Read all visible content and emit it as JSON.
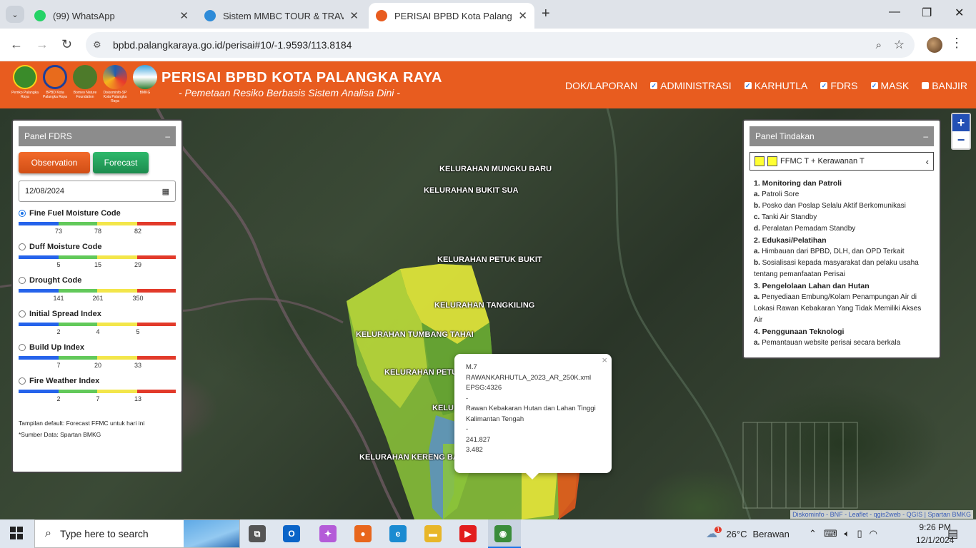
{
  "browser": {
    "tabs": [
      {
        "title": "(99) WhatsApp",
        "icon": "whatsapp-icon",
        "color": "#25d366"
      },
      {
        "title": "Sistem MMBC TOUR & TRAVEL",
        "icon": "site-icon",
        "color": "#2e8bd8"
      },
      {
        "title": "PERISAI BPBD Kota Palangka Ra",
        "icon": "bpbd-icon",
        "color": "#e85c1f"
      }
    ],
    "url": "bpbd.palangkaraya.go.id/perisai#10/-1.9593/113.8184"
  },
  "header": {
    "title": "PERISAI BPBD KOTA PALANGKA RAYA",
    "subtitle": "- Pemetaan Resiko Berbasis Sistem Analisa Dini -",
    "logos": [
      {
        "caption": "Pemko Palangka Raya",
        "color": "#3a8b2a"
      },
      {
        "caption": "BPBD Kota Palangka Raya",
        "color": "#1d3f9a"
      },
      {
        "caption": "Borneo Nature Foundation",
        "color": "#4d7a2a"
      },
      {
        "caption": "Diskominfo-SP Kota Palangka Raya",
        "color": "#1f5fb0"
      },
      {
        "caption": "BMKG",
        "color": "#2f86c7"
      }
    ],
    "nav": [
      {
        "label": "DOK/LAPORAN",
        "checkbox": false
      },
      {
        "label": "ADMINISTRASI",
        "checkbox": true,
        "checked": true
      },
      {
        "label": "KARHUTLA",
        "checkbox": true,
        "checked": true
      },
      {
        "label": "FDRS",
        "checkbox": true,
        "checked": true
      },
      {
        "label": "MASK",
        "checkbox": true,
        "checked": true
      },
      {
        "label": "BANJIR",
        "checkbox": true,
        "checked": false
      }
    ]
  },
  "panel_fdrs": {
    "title": "Panel FDRS",
    "collapse": "–",
    "observation_label": "Observation",
    "forecast_label": "Forecast",
    "date": "12/08/2024",
    "indices": [
      {
        "name": "Fine Fuel Moisture Code",
        "selected": true,
        "ticks": [
          "73",
          "78",
          "82"
        ]
      },
      {
        "name": "Duff Moisture Code",
        "selected": false,
        "ticks": [
          "5",
          "15",
          "29"
        ]
      },
      {
        "name": "Drought Code",
        "selected": false,
        "ticks": [
          "141",
          "261",
          "350"
        ]
      },
      {
        "name": "Initial Spread Index",
        "selected": false,
        "ticks": [
          "2",
          "4",
          "5"
        ]
      },
      {
        "name": "Build Up Index",
        "selected": false,
        "ticks": [
          "7",
          "20",
          "33"
        ]
      },
      {
        "name": "Fire Weather Index",
        "selected": false,
        "ticks": [
          "2",
          "7",
          "13"
        ]
      }
    ],
    "scale_colors": [
      "#2563eb",
      "#62c95a",
      "#f3e64a",
      "#e23a2a"
    ],
    "note1": "Tampilan default: Forecast FFMC untuk hari ini",
    "note2": "*Sumber Data: Spartan BMKG"
  },
  "panel_tindakan": {
    "title": "Panel Tindakan",
    "collapse": "–",
    "select_label": "FFMC T + Kerawanan T",
    "sections": [
      {
        "head": "1. Monitoring dan Patroli",
        "items": [
          {
            "k": "a.",
            "t": "Patroli Sore"
          },
          {
            "k": "b.",
            "t": "Posko dan Poslap Selalu Aktif Berkomunikasi"
          },
          {
            "k": "c.",
            "t": "Tanki Air Standby"
          },
          {
            "k": "d.",
            "t": "Peralatan Pemadam Standby"
          }
        ]
      },
      {
        "head": "2. Edukasi/Pelatihan",
        "items": [
          {
            "k": "a.",
            "t": "Himbauan dari BPBD, DLH, dan OPD Terkait"
          },
          {
            "k": "b.",
            "t": "Sosialisasi kepada masyarakat dan pelaku usaha tentang pemanfaatan Perisai"
          }
        ]
      },
      {
        "head": "3. Pengelolaan Lahan dan Hutan",
        "items": [
          {
            "k": "a.",
            "t": "Penyediaan Embung/Kolam Penampungan Air di Lokasi Rawan Kebakaran Yang Tidak Memiliki Akses Air"
          }
        ]
      },
      {
        "head": "4. Penggunaan Teknologi",
        "items": [
          {
            "k": "a.",
            "t": "Pemantauan website perisai secara berkala"
          }
        ]
      }
    ]
  },
  "map": {
    "labels": [
      "KELURAHAN MUNGKU BARU",
      "KELURAHAN BUKIT SUA",
      "KELURAHAN PETUK BUKIT",
      "KELURAHAN TANGKILING",
      "KELURAHAN TUMBANG TAHAI",
      "KELURAHAN PETU",
      "KELU",
      "KELURAHAN KERENG BA"
    ],
    "zoom_in": "+",
    "zoom_out": "−",
    "attribution": "Diskominfo - BNF - Leaflet - qgis2web - QGIS | Spartan BMKG",
    "popup": {
      "lines": [
        "M.7",
        "RAWANKARHUTLA_2023_AR_250K.xml",
        "EPSG:4326",
        "-",
        "Rawan Kebakaran Hutan dan Lahan Tinggi",
        "Kalimantan Tengah",
        "-",
        "241.827",
        "3.482"
      ],
      "close": "×"
    },
    "colors": {
      "yellow": "#e3e23a",
      "yellowgreen": "#b7d43a",
      "green": "#8cc63a",
      "darkgreen": "#5e9e32",
      "blue": "#5a90c8",
      "red": "#e0561c"
    }
  },
  "taskbar": {
    "search_placeholder": "Type here to search",
    "weather_temp": "26°C",
    "weather_text": "Berawan",
    "weather_badge": "1",
    "time": "9:26 PM",
    "date": "12/1/2024",
    "apps": [
      {
        "name": "task-view-icon",
        "label": "⧉",
        "color": "#555"
      },
      {
        "name": "outlook-icon",
        "label": "O",
        "color": "#0a64c8"
      },
      {
        "name": "copilot-icon",
        "label": "✦",
        "color": "#b45bd8"
      },
      {
        "name": "firefox-icon",
        "label": "●",
        "color": "#e8661c"
      },
      {
        "name": "edge-icon",
        "label": "e",
        "color": "#1b8bd1"
      },
      {
        "name": "file-explorer-icon",
        "label": "▬",
        "color": "#e8b628"
      },
      {
        "name": "youtube-icon",
        "label": "▶",
        "color": "#e21d1d"
      },
      {
        "name": "chrome-icon",
        "label": "◉",
        "color": "#3a8c3a"
      }
    ]
  }
}
